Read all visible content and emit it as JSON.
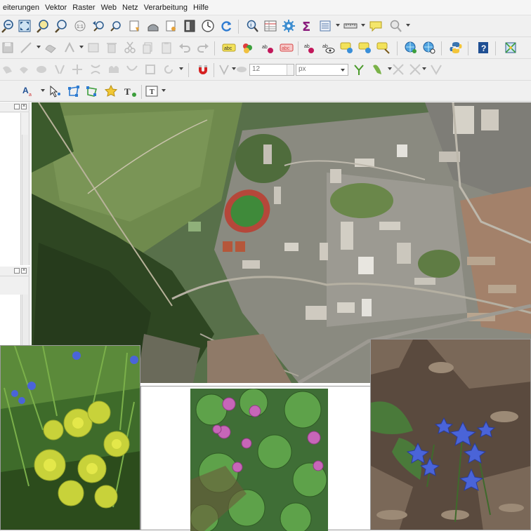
{
  "menubar": {
    "items": [
      "eiterungen",
      "Vektor",
      "Raster",
      "Web",
      "Netz",
      "Verarbeitung",
      "Hilfe"
    ]
  },
  "snapping": {
    "tolerance_value": "12",
    "unit": "px"
  },
  "colors": {
    "toolbar_bg": "#f0f0f0",
    "panel_bg": "#f0f0f0",
    "map_forest": "#2f4a22",
    "map_grass": "#6d8a4a",
    "track_red": "#b5473a",
    "flower_blue": "#4a64d8",
    "flower_pink": "#c766b8",
    "flower_yellow": "#c8d23a"
  },
  "icons": {
    "toolbar1": [
      "zoom-out-icon",
      "zoom-full-icon",
      "zoom-to-layer-icon",
      "zoom-to-selection-icon",
      "zoom-native-icon",
      "zoom-last-icon",
      "zoom-next-icon",
      "new-bookmark-icon",
      "show-bookmarks-icon",
      "temporal-controller-icon",
      "refresh-icon",
      "identify-icon",
      "attribute-table-icon",
      "processing-toolbox-icon",
      "statistics-sum-icon",
      "field-calculator-icon",
      "measure-icon",
      "map-tips-icon",
      "annotation-icon"
    ],
    "toolbar2": [
      "save-edits-icon",
      "digitize-icon",
      "vertex-tool-icon",
      "delete-selected-icon",
      "cut-features-icon",
      "copy-features-icon",
      "paste-features-icon",
      "undo-icon",
      "redo-icon",
      "label-abc-icon",
      "label-pin-icon",
      "label-show-icon",
      "label-move-icon",
      "label-rotate-icon",
      "label-change-icon",
      "python-icon",
      "help-icon",
      "georeferencer-icon"
    ],
    "toolbar3": [
      "advanced-digitizing-icon",
      "magnet-snapping-icon",
      "snapping-tolerance-input",
      "unit-dropdown",
      "trace-icon",
      "split-icon",
      "merge-icon"
    ],
    "toolbar4": [
      "text-annotation-icon",
      "select-features-icon",
      "node-tool-icon",
      "star-icon",
      "text-format-icon"
    ]
  }
}
